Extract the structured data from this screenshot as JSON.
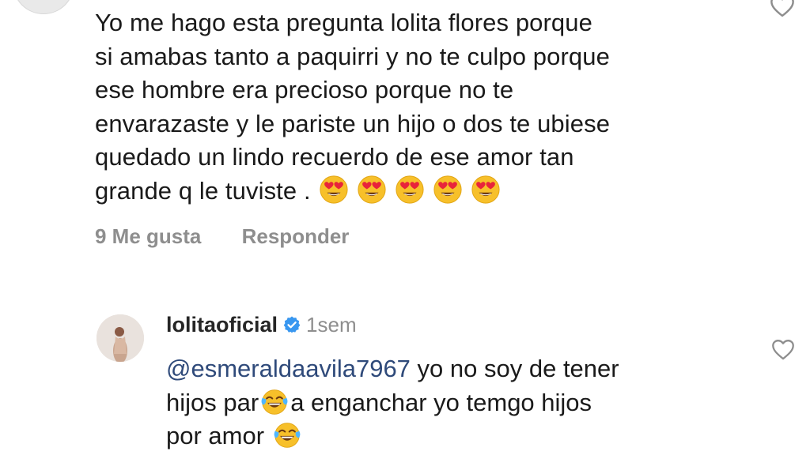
{
  "first_comment": {
    "lines": [
      "Yo me hago esta pregunta lolita flores porque",
      "si amabas tanto a paquirri y no te culpo porque",
      "ese hombre era precioso porque no te",
      "envarazaste y le pariste un hijo o dos te ubiese",
      "quedado un lindo recuerdo de ese amor tan",
      "grande q le tuviste ."
    ],
    "emojis": [
      "heart-eyes-emoji",
      "heart-eyes-emoji",
      "heart-eyes-emoji",
      "heart-eyes-emoji",
      "heart-eyes-emoji"
    ],
    "likes": "9 Me gusta",
    "reply_label": "Responder"
  },
  "reply": {
    "username": "lolitaoficial",
    "timestamp": "1sem",
    "mention": "@esmeraldaavila7967",
    "line1_rest": " yo no soy de tener",
    "line2_before": "hijos par",
    "line2_after": "a enganchar yo temgo hijos",
    "line3": "por amor ",
    "emojis": [
      "tears-of-joy-emoji",
      "tears-of-joy-emoji"
    ]
  },
  "colors": {
    "text": "#1a1a1a",
    "meta": "#8e8e8e",
    "mention": "#2f4a7a",
    "verified": "#3897f0",
    "emoji_face": "#f7c02a"
  }
}
